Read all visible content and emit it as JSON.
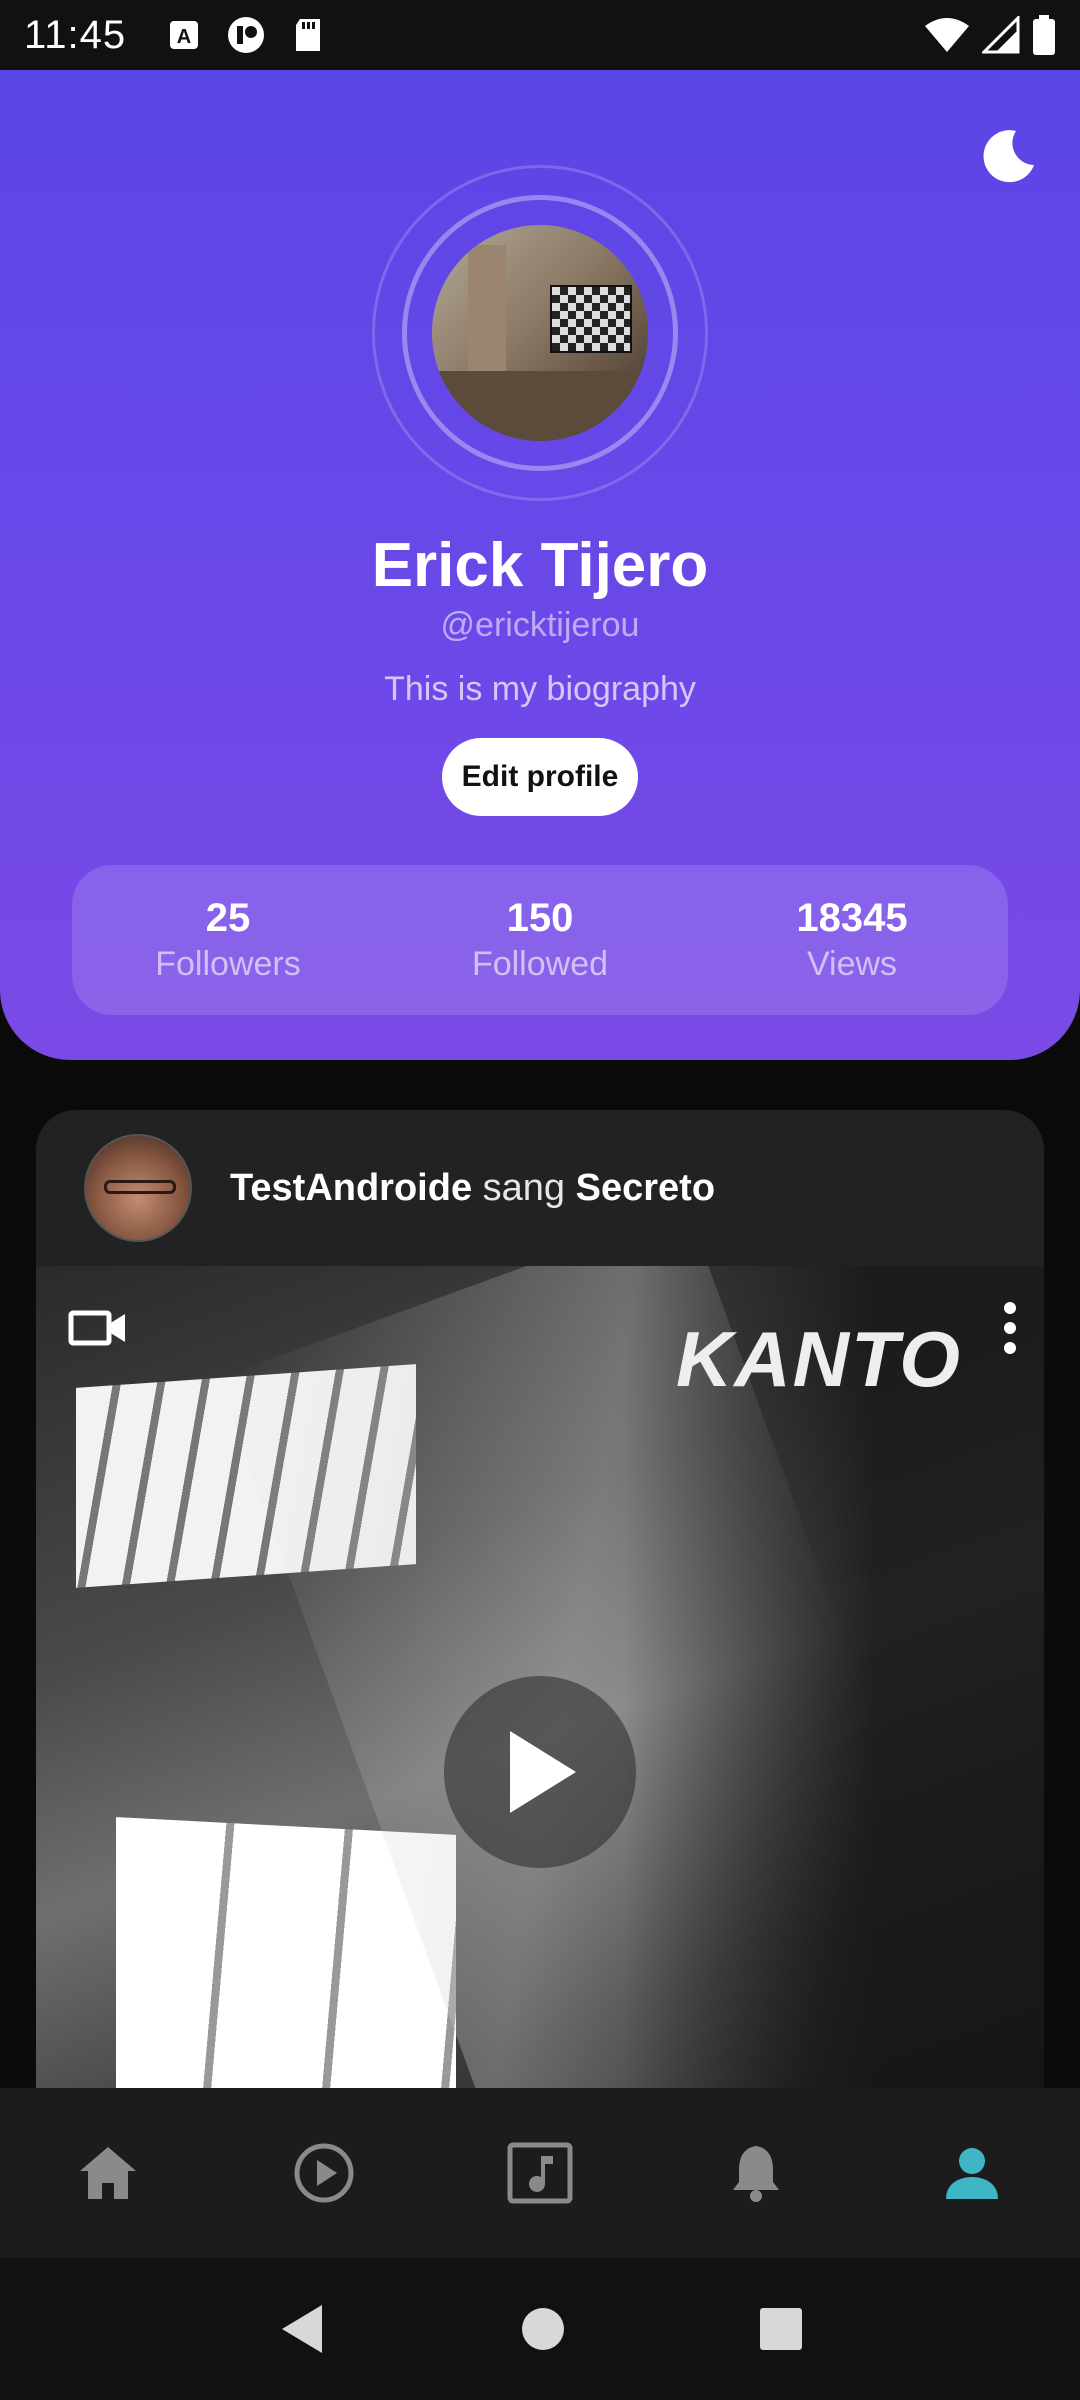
{
  "status_bar": {
    "time": "11:45"
  },
  "profile": {
    "name": "Erick Tijero",
    "handle": "@ericktijerou",
    "bio": "This is my biography",
    "edit_label": "Edit profile",
    "stats": [
      {
        "value": "25",
        "label": "Followers"
      },
      {
        "value": "150",
        "label": "Followed"
      },
      {
        "value": "18345",
        "label": "Views"
      }
    ]
  },
  "post": {
    "user": "TestAndroide",
    "verb": "sang",
    "song": "Secreto",
    "watermark": "KANTO"
  },
  "bottom_nav": [
    {
      "icon": "home-icon"
    },
    {
      "icon": "play-circle-icon"
    },
    {
      "icon": "music-icon"
    },
    {
      "icon": "bell-icon"
    },
    {
      "icon": "person-icon",
      "active": true
    }
  ],
  "colors": {
    "header_gradient_top": "#5b46e6",
    "header_gradient_bottom": "#7a4ae6",
    "active_nav": "#3fb6c5",
    "inactive_nav": "#8a8a8a"
  }
}
